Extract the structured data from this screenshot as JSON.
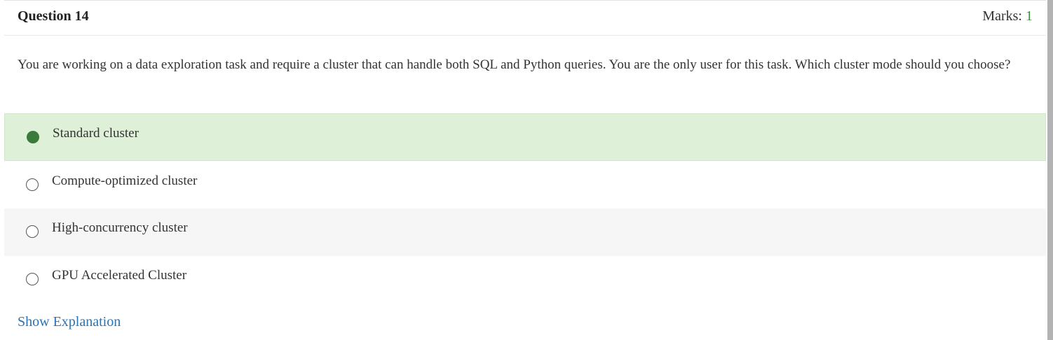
{
  "question": {
    "title": "Question 14",
    "marks_label": "Marks:",
    "marks_value": "1",
    "text": "You are working on a data exploration task and require a cluster that can handle both SQL and Python queries. You are the only user for this task. Which cluster mode should you choose?"
  },
  "options": [
    {
      "label": "Standard cluster",
      "selected": true
    },
    {
      "label": "Compute-optimized cluster",
      "selected": false
    },
    {
      "label": "High-concurrency cluster",
      "selected": false
    },
    {
      "label": "GPU Accelerated Cluster",
      "selected": false
    }
  ],
  "explanation": {
    "link_label": "Show Explanation"
  },
  "colors": {
    "selected_bg": "#dff0d8",
    "selected_radio": "#3a7a3a",
    "marks_value": "#3c8a3c",
    "link": "#2a73b5",
    "alt_row_bg": "#f6f6f6"
  }
}
